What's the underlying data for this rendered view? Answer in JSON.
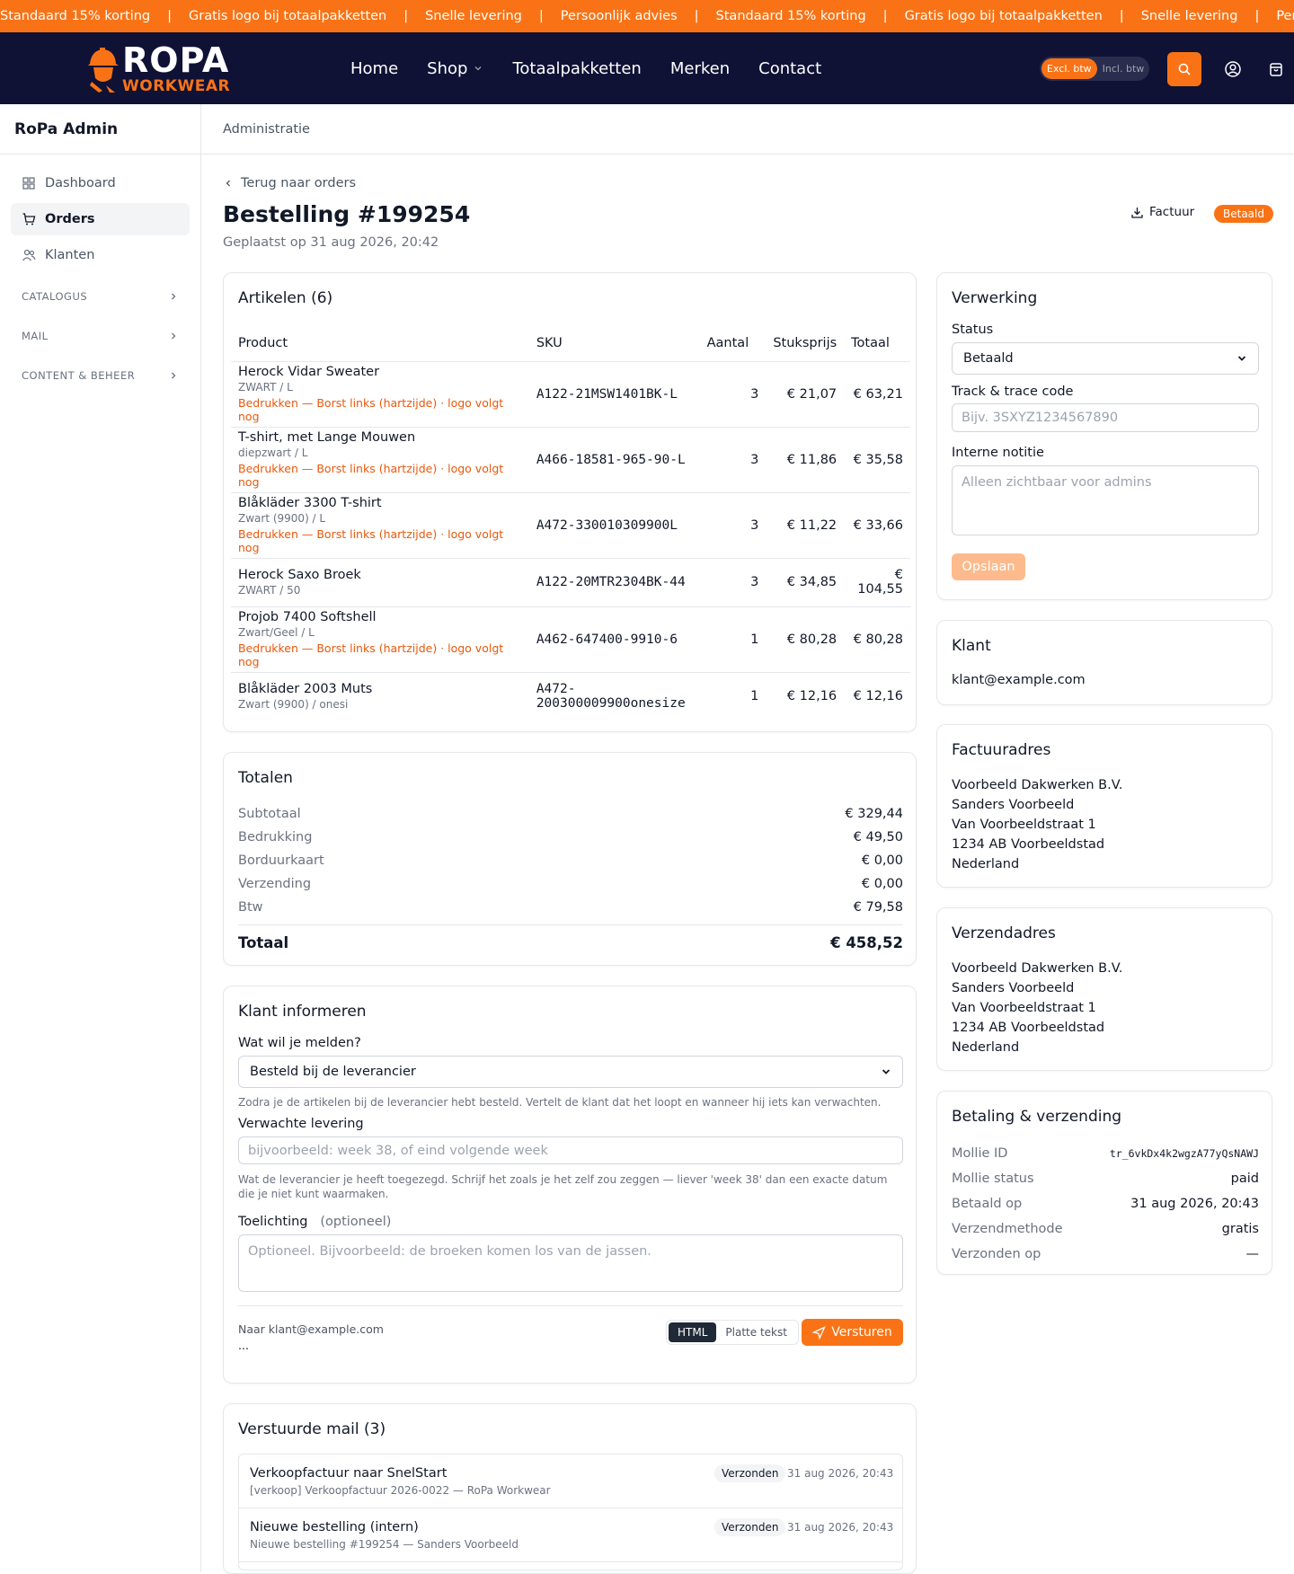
{
  "ticker": [
    "Standaard 15% korting",
    "Gratis logo bij totaalpakketten",
    "Snelle levering",
    "Persoonlijk advies",
    "Standaard 15% korting",
    "Gratis logo bij totaalpakketten",
    "Snelle levering",
    "Persoonlijk advies"
  ],
  "ticker_sep": "|",
  "brand": {
    "name": "ROPA",
    "sub": "WORKWEAR"
  },
  "menu": {
    "home": "Home",
    "shop": "Shop",
    "packages": "Totaalpakketten",
    "brands": "Merken",
    "contact": "Contact"
  },
  "btw": {
    "excl": "Excl. btw",
    "incl": "Incl. btw"
  },
  "sidebar": {
    "title": "RoPa Admin",
    "items": [
      {
        "label": "Dashboard"
      },
      {
        "label": "Orders"
      },
      {
        "label": "Klanten"
      }
    ],
    "sections": [
      {
        "label": "CATALOGUS"
      },
      {
        "label": "MAIL"
      },
      {
        "label": "CONTENT & BEHEER"
      }
    ]
  },
  "topstrip": "Administratie",
  "order": {
    "back": "Terug naar orders",
    "title": "Bestelling #199254",
    "placed": "Geplaatst op 31 aug 2026, 20:42",
    "invoice": "Factuur",
    "status_badge": "Betaald"
  },
  "items": {
    "title": "Artikelen (6)",
    "headers": {
      "product": "Product",
      "sku": "SKU",
      "qty": "Aantal",
      "price": "Stuksprijs",
      "total": "Totaal"
    },
    "rows": [
      {
        "name": "Herock Vidar Sweater",
        "variant": "ZWART / L",
        "print": "Bedrukken — Borst links (hartzijde) · logo volgt nog",
        "sku": "A122-21MSW1401BK-L",
        "qty": "3",
        "price": "€ 21,07",
        "total": "€ 63,21"
      },
      {
        "name": "T-shirt, met Lange Mouwen",
        "variant": "diepzwart / L",
        "print": "Bedrukken — Borst links (hartzijde) · logo volgt nog",
        "sku": "A466-18581-965-90-L",
        "qty": "3",
        "price": "€ 11,86",
        "total": "€ 35,58"
      },
      {
        "name": "Blåkläder 3300 T-shirt",
        "variant": "Zwart (9900) / L",
        "print": "Bedrukken — Borst links (hartzijde) · logo volgt nog",
        "sku": "A472-330010309900L",
        "qty": "3",
        "price": "€ 11,22",
        "total": "€ 33,66"
      },
      {
        "name": "Herock Saxo Broek",
        "variant": "ZWART / 50",
        "print": "",
        "sku": "A122-20MTR2304BK-44",
        "qty": "3",
        "price": "€ 34,85",
        "total": "€ 104,55"
      },
      {
        "name": "Projob 7400 Softshell",
        "variant": "Zwart/Geel / L",
        "print": "Bedrukken — Borst links (hartzijde) · logo volgt nog",
        "sku": "A462-647400-9910-6",
        "qty": "1",
        "price": "€ 80,28",
        "total": "€ 80,28"
      },
      {
        "name": "Blåkläder 2003 Muts",
        "variant": "Zwart (9900) / onesi",
        "print": "",
        "sku": "A472-200300009900onesize",
        "qty": "1",
        "price": "€ 12,16",
        "total": "€ 12,16"
      }
    ]
  },
  "totals": {
    "title": "Totalen",
    "rows": [
      {
        "label": "Subtotaal",
        "value": "€ 329,44"
      },
      {
        "label": "Bedrukking",
        "value": "€ 49,50"
      },
      {
        "label": "Borduurkaart",
        "value": "€ 0,00"
      },
      {
        "label": "Verzending",
        "value": "€ 0,00"
      },
      {
        "label": "Btw",
        "value": "€ 79,58"
      }
    ],
    "grand_label": "Totaal",
    "grand_value": "€ 458,52"
  },
  "notify": {
    "title": "Klant informeren",
    "what_label": "Wat wil je melden?",
    "what_value": "Besteld bij de leverancier",
    "what_hint": "Zodra je de artikelen bij de leverancier hebt besteld. Vertelt de klant dat het loopt en wanneer hij iets kan verwachten.",
    "delivery_label": "Verwachte levering",
    "delivery_placeholder": "bijvoorbeeld: week 38, of eind volgende week",
    "delivery_hint": "Wat de leverancier je heeft toegezegd. Schrijf het zoals je het zelf zou zeggen — liever 'week 38' dan een exacte datum die je niet kunt waarmaken.",
    "note_label": "Toelichting",
    "note_optional": "(optioneel)",
    "note_placeholder": "Optioneel. Bijvoorbeeld: de broeken komen los van de jassen.",
    "to": "Naar klant@example.com",
    "ellipsis": "...",
    "fmt_html": "HTML",
    "fmt_plain": "Platte tekst",
    "send": "Versturen"
  },
  "sent": {
    "title": "Verstuurde mail (3)",
    "items": [
      {
        "subject": "Verkoopfactuur naar SnelStart",
        "detail": "[verkoop] Verkoopfactuur 2026-0022 — RoPa Workwear",
        "status": "Verzonden",
        "date": "31 aug 2026, 20:43"
      },
      {
        "subject": "Nieuwe bestelling (intern)",
        "detail": "Nieuwe bestelling #199254 — Sanders Voorbeeld",
        "status": "Verzonden",
        "date": "31 aug 2026, 20:43"
      }
    ]
  },
  "processing": {
    "title": "Verwerking",
    "status_label": "Status",
    "status_value": "Betaald",
    "track_label": "Track & trace code",
    "track_placeholder": "Bijv. 3SXYZ1234567890",
    "note_label": "Interne notitie",
    "note_placeholder": "Alleen zichtbaar voor admins",
    "save": "Opslaan"
  },
  "customer": {
    "title": "Klant",
    "email": "klant@example.com"
  },
  "billing": {
    "title": "Factuuradres",
    "lines": [
      "Voorbeeld Dakwerken B.V.",
      "Sanders Voorbeeld",
      "Van Voorbeeldstraat 1",
      "1234 AB Voorbeeldstad",
      "Nederland"
    ]
  },
  "shipping": {
    "title": "Verzendadres",
    "lines": [
      "Voorbeeld Dakwerken B.V.",
      "Sanders Voorbeeld",
      "Van Voorbeeldstraat 1",
      "1234 AB Voorbeeldstad",
      "Nederland"
    ]
  },
  "payment": {
    "title": "Betaling & verzending",
    "rows": [
      {
        "label": "Mollie ID",
        "value": "tr_6vkDx4k2wgzA77yQsNAWJ"
      },
      {
        "label": "Mollie status",
        "value": "paid"
      },
      {
        "label": "Betaald op",
        "value": "31 aug 2026, 20:43"
      },
      {
        "label": "Verzendmethode",
        "value": "gratis"
      },
      {
        "label": "Verzonden op",
        "value": "—"
      }
    ]
  },
  "colors": {
    "accent": "#f97316",
    "nav": "#0f1235"
  }
}
